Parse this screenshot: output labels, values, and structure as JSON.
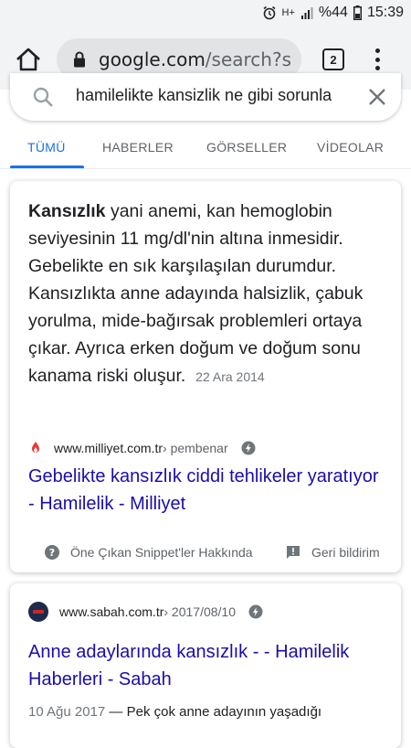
{
  "status": {
    "time": "15:39",
    "battery": "%44",
    "signal": "H+"
  },
  "browser": {
    "url_domain": "google.com",
    "url_path": "/search?s",
    "tab_count": "2"
  },
  "search": {
    "query": "hamilelikte kansizlik ne gibi sorunla"
  },
  "tabs": [
    {
      "label": "TÜMÜ",
      "active": true
    },
    {
      "label": "HABERLER"
    },
    {
      "label": "GÖRSELLER"
    },
    {
      "label": "VİDEOLAR"
    }
  ],
  "featured": {
    "bold": "Kansızlık",
    "text": " yani anemi, kan hemoglobin seviyesinin 11 mg/dl'nin altına inmesidir. Gebelikte en sık karşılaşılan durumdur. Kansızlıkta anne adayında halsizlik, çabuk yorulma, mide-bağırsak problemleri ortaya çıkar. Ayrıca erken doğum ve doğum sonu kanama riski oluşur.",
    "date": "22 Ara 2014",
    "source_domain": "www.milliyet.com.tr",
    "source_crumb": " › pembenar",
    "title": "Gebelikte kansızlık ciddi tehlikeler yaratıyor - Hamilelik - Milliyet",
    "about_label": "Öne Çıkan Snippet'ler Hakkında",
    "feedback_label": "Geri bildirim"
  },
  "result2": {
    "source_domain": "www.sabah.com.tr",
    "source_crumb": " › 2017/08/10",
    "title": "Anne adaylarında kansızlık - - Hamilelik Haberleri - Sabah",
    "date": "10 Ağu 2017",
    "snippet": " — Pek çok anne adayının yaşadığı"
  },
  "colors": {
    "link": "#1a0dab",
    "accent": "#1a73e8",
    "chrome_bg": "#f1f3f4"
  }
}
